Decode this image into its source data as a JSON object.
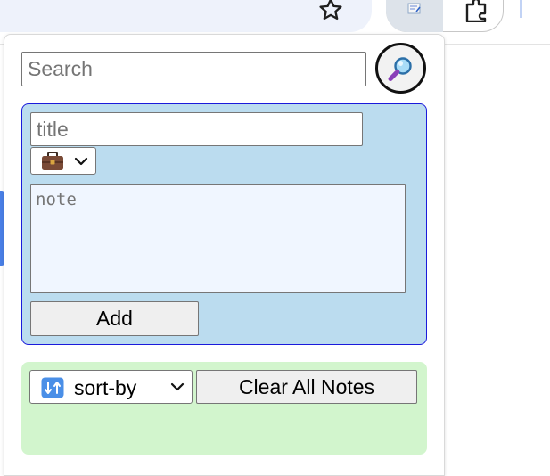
{
  "browser": {
    "bookmark_icon": "star-outline-icon",
    "active_extension_icon": "notepad-icon",
    "extensions_icon": "puzzle-piece-icon"
  },
  "popup": {
    "search": {
      "placeholder": "Search",
      "value": "",
      "button_icon": "magnifying-glass-icon"
    },
    "add_note": {
      "title_placeholder": "title",
      "title_value": "",
      "category_selected": "💼",
      "category_icon": "briefcase-icon",
      "note_placeholder": "note",
      "note_value": "",
      "add_label": "Add"
    },
    "controls": {
      "sort_icon": "🔃",
      "sort_label": "sort-by",
      "clear_label": "Clear All Notes"
    }
  },
  "colors": {
    "add_panel_bg": "#bbdcef",
    "add_panel_border": "#1a1adb",
    "sort_panel_bg": "#d2f5cd",
    "note_bg": "#f0f6ff",
    "search_button_bg": "#f2f2f2"
  }
}
